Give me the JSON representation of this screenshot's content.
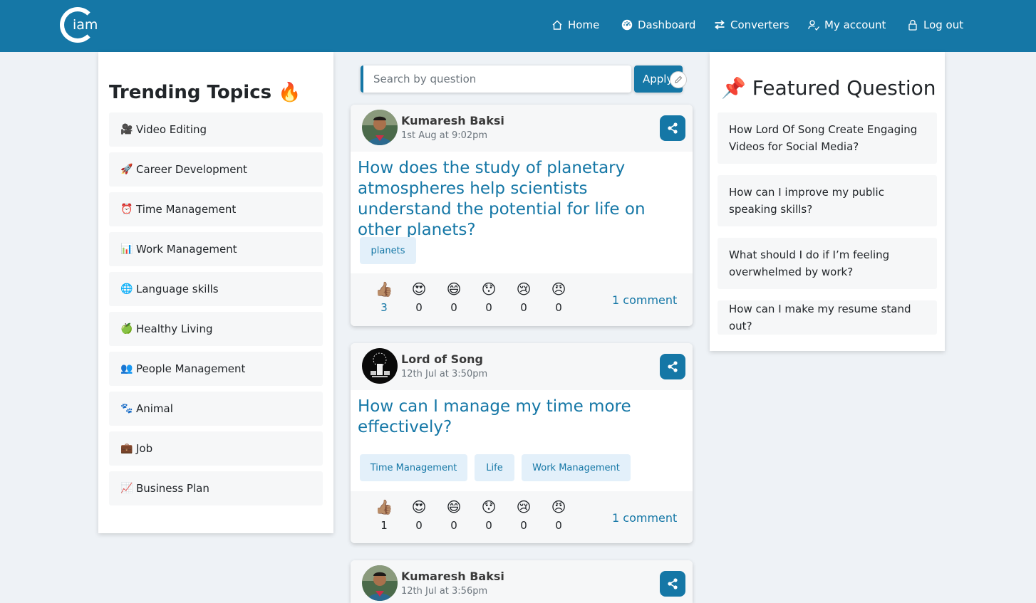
{
  "navbar": {
    "logo_text": "iam",
    "items": [
      {
        "label": "Home",
        "icon": "home-icon"
      },
      {
        "label": "Dashboard",
        "icon": "dashboard-icon"
      },
      {
        "label": "Converters",
        "icon": "arrows-icon"
      },
      {
        "label": "My account",
        "icon": "user-icon"
      },
      {
        "label": "Log out",
        "icon": "lock-icon"
      }
    ]
  },
  "left": {
    "title": "Trending Topics",
    "title_emoji": "🔥",
    "topics": [
      {
        "emoji": "🎥",
        "label": "Video Editing"
      },
      {
        "emoji": "🚀",
        "label": "Career Development"
      },
      {
        "emoji": "⏰",
        "label": "Time Management"
      },
      {
        "emoji": "📊",
        "label": "Work Management"
      },
      {
        "emoji": "🌐",
        "label": "Language skills"
      },
      {
        "emoji": "🍏",
        "label": "Healthy Living"
      },
      {
        "emoji": "👥",
        "label": "People Management"
      },
      {
        "emoji": "🐾",
        "label": "Animal"
      },
      {
        "emoji": "💼",
        "label": "Job"
      },
      {
        "emoji": "📈",
        "label": "Business Plan"
      }
    ]
  },
  "search": {
    "placeholder": "Search by question",
    "apply_label": "Apply"
  },
  "reaction_emojis": [
    "👍🏽",
    "😍",
    "😄",
    "😯",
    "😢",
    "😠"
  ],
  "posts": [
    {
      "author": "Kumaresh Baksi",
      "date": "1st Aug at 9:02pm",
      "title": "How does the study of planetary atmospheres help scientists understand the potential for life on other planets?",
      "tags": [
        "planets"
      ],
      "reactions": [
        3,
        0,
        0,
        0,
        0,
        0
      ],
      "comments": "1 comment"
    },
    {
      "author": "Lord of Song",
      "date": "12th Jul at 3:50pm",
      "title": "How can I manage my time more effectively?",
      "tags": [
        "Time Management",
        "Life",
        "Work Management"
      ],
      "reactions": [
        1,
        0,
        0,
        0,
        0,
        0
      ],
      "comments": "1 comment"
    },
    {
      "author": "Kumaresh Baksi",
      "date": "12th Jul at 3:56pm"
    }
  ],
  "right": {
    "title": "Featured Question",
    "title_emoji": "📌",
    "questions": [
      "How Lord Of Song Create Engaging Videos for Social Media?",
      "How can I improve my public speaking skills?",
      "What should I do if I’m feeling overwhelmed by work?",
      "How can I make my resume stand out?"
    ]
  },
  "colors": {
    "brand": "#1577a6",
    "background": "#eef2f6",
    "tag_bg": "#e3f0fa"
  }
}
